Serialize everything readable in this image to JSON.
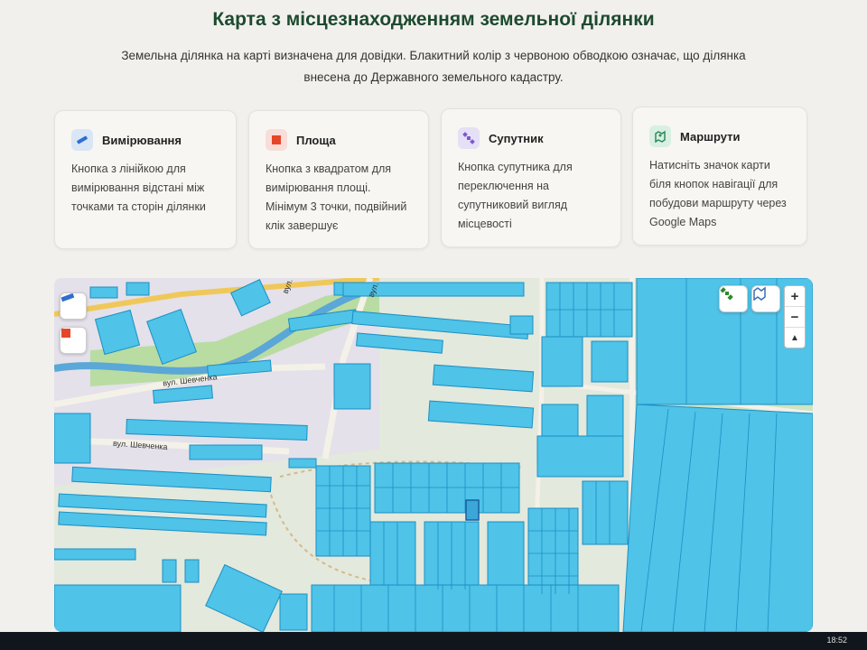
{
  "header": {
    "title": "Карта з місцезнаходженням земельної ділянки",
    "subtitle": "Земельна ділянка на карті визначена для довідки. Блакитний колір з червоною обводкою означає, що ділянка внесена до Державного земельного кадастру."
  },
  "cards": [
    {
      "title": "Вимірювання",
      "text": "Кнопка з лінійкою для вимірювання відстані між точками та сторін ділянки",
      "icon": "ruler-icon",
      "icon_bg": "#d8e6f6",
      "icon_color": "#2f6fcf"
    },
    {
      "title": "Площа",
      "text": "Кнопка з квадратом для вимірювання площі. Мінімум 3 точки, подвійний клік завершує",
      "icon": "square-icon",
      "icon_bg": "#f8ddd8",
      "icon_color": "#e6452a"
    },
    {
      "title": "Супутник",
      "text": "Кнопка супутника для переключення на супутниковий вигляд місцевості",
      "icon": "satellite-icon",
      "icon_bg": "#e6e0f6",
      "icon_color": "#7a5ad0"
    },
    {
      "title": "Маршрути",
      "text": "Натисніть значок карти біля кнопок навігації для побудови маршруту через Google Maps",
      "icon": "map-route-icon",
      "icon_bg": "#d8efe2",
      "icon_color": "#2f8a5a"
    }
  ],
  "map": {
    "streets": [
      "вул. Шевченка",
      "вул. Шевченка",
      "вул.",
      "вул."
    ],
    "zoom_in": "+",
    "zoom_out": "−",
    "compass": "▲"
  },
  "taskbar": {
    "time": "18:52"
  },
  "colors": {
    "parcel_fill": "#4fc3e8",
    "parcel_stroke": "#1b8fc4",
    "title": "#1d4a2f",
    "road": "#f4f1e8",
    "green": "#b9dca2",
    "river": "#5aa7d8"
  }
}
